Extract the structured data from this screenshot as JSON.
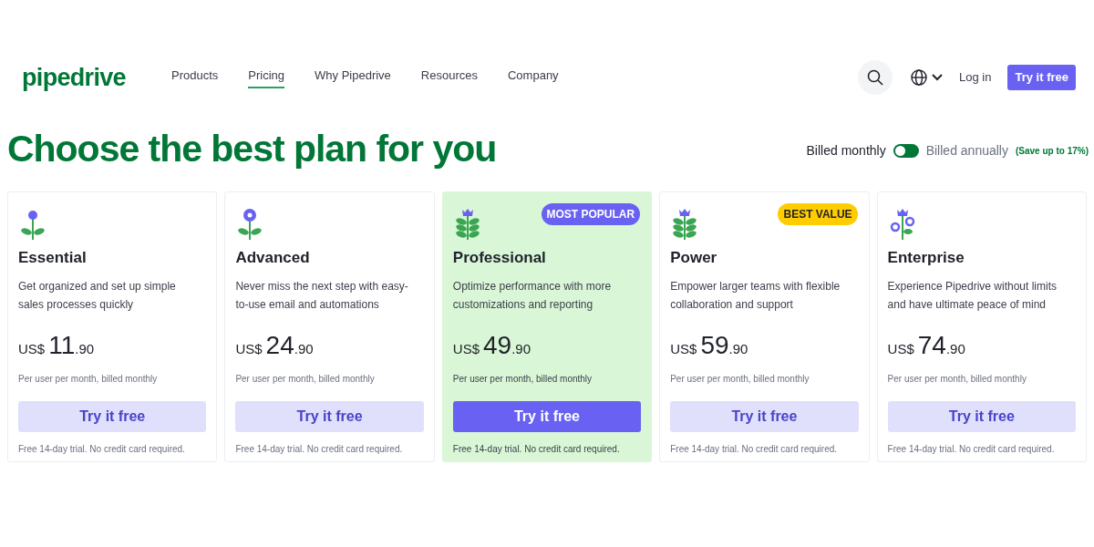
{
  "logo": "pipedrive",
  "nav": [
    {
      "label": "Products",
      "selected": false
    },
    {
      "label": "Pricing",
      "selected": true
    },
    {
      "label": "Why Pipedrive",
      "selected": false
    },
    {
      "label": "Resources",
      "selected": false
    },
    {
      "label": "Company",
      "selected": false
    }
  ],
  "header_actions": {
    "login": "Log in",
    "cta": "Try it free"
  },
  "heading": "Choose the best plan for you",
  "billing": {
    "monthly_label": "Billed monthly",
    "annual_label": "Billed annually",
    "savings": "(Save up to 17%)",
    "annual": false
  },
  "plans": [
    {
      "name": "Essential",
      "description": "Get organized and set up simple sales processes quickly",
      "currency": "US$",
      "price": "11",
      "cents": ".90",
      "period": "Per user per month, billed monthly",
      "button": "Try it free",
      "note": "Free 14-day trial. No credit card required.",
      "featured": false
    },
    {
      "name": "Advanced",
      "description": "Never miss the next step with easy-to-use email and automations",
      "currency": "US$",
      "price": "24",
      "cents": ".90",
      "period": "Per user per month, billed monthly",
      "button": "Try it free",
      "note": "Free 14-day trial. No credit card required.",
      "featured": false
    },
    {
      "name": "Professional",
      "description": "Optimize performance with more customizations and reporting",
      "currency": "US$",
      "price": "49",
      "cents": ".90",
      "period": "Per user per month, billed monthly",
      "button": "Try it free",
      "note": "Free 14-day trial. No credit card required.",
      "featured": true,
      "badge": {
        "text": "MOST POPULAR",
        "color": "#6861f2"
      }
    },
    {
      "name": "Power",
      "description": "Empower larger teams with flexible collaboration and support",
      "currency": "US$",
      "price": "59",
      "cents": ".90",
      "period": "Per user per month, billed monthly",
      "button": "Try it free",
      "note": "Free 14-day trial. No credit card required.",
      "featured": false,
      "badge": {
        "text": "BEST VALUE",
        "color": "#ffcc00"
      }
    },
    {
      "name": "Enterprise",
      "description": "Experience Pipedrive without limits and have ultimate peace of mind",
      "currency": "US$",
      "price": "74",
      "cents": ".90",
      "period": "Per user per month, billed monthly",
      "button": "Try it free",
      "note": "Free 14-day trial. No credit card required.",
      "featured": false
    }
  ]
}
